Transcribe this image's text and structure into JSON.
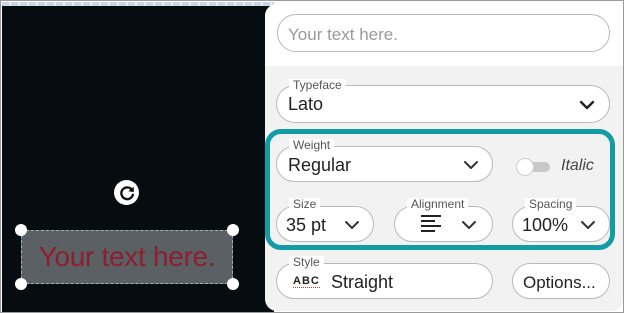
{
  "canvas": {
    "text": "Your text here.",
    "text_color": "#8e1f2f",
    "background": "#050d10"
  },
  "panel": {
    "text_input": {
      "placeholder": "Your text here."
    },
    "typeface": {
      "label": "Typeface",
      "value": "Lato"
    },
    "weight": {
      "label": "Weight",
      "value": "Regular"
    },
    "italic": {
      "label": "Italic",
      "on": false
    },
    "size": {
      "label": "Size",
      "value": "35 pt"
    },
    "alignment": {
      "label": "Alignment",
      "value": "left-align-icon"
    },
    "spacing": {
      "label": "Spacing",
      "value": "100%"
    },
    "style": {
      "label": "Style",
      "value": "Straight",
      "icon_text": "ABC"
    },
    "options_button": "Options...",
    "accent_color": "#139ba6"
  }
}
